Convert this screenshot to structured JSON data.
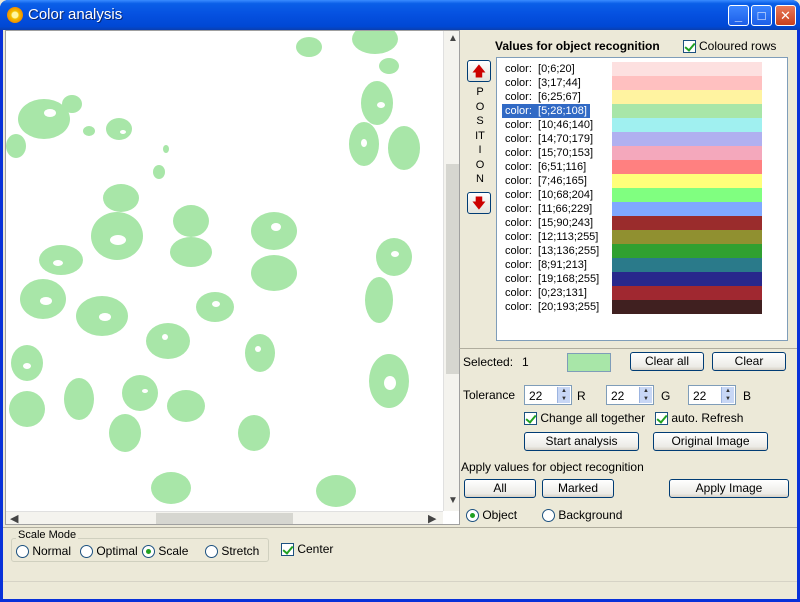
{
  "window": {
    "title": "Color analysis",
    "controls": [
      "_",
      "□",
      "✕"
    ]
  },
  "panel": {
    "title": "Values for object recognition",
    "coloured_rows_label": "Coloured rows",
    "coloured_rows_checked": true,
    "position_label": "POSITION"
  },
  "rows": [
    {
      "label": "color:  [0;6;20]",
      "color": "#fde0e0"
    },
    {
      "label": "color:  [3;17;44]",
      "color": "#ffc0c0"
    },
    {
      "label": "color:  [6;25;67]",
      "color": "#fff3a0"
    },
    {
      "label": "color:  [5;28;108]",
      "color": "#a8e6a8",
      "selected": true
    },
    {
      "label": "color:  [10;46;140]",
      "color": "#a0f0f0"
    },
    {
      "label": "color:  [14;70;179]",
      "color": "#b0b0f0"
    },
    {
      "label": "color:  [15;70;153]",
      "color": "#f4a8bc"
    },
    {
      "label": "color:  [6;51;116]",
      "color": "#ff8080"
    },
    {
      "label": "color:  [7;46;165]",
      "color": "#ffff7a"
    },
    {
      "label": "color:  [10;68;204]",
      "color": "#80ff80"
    },
    {
      "label": "color:  [11;66;229]",
      "color": "#7fa8ff"
    },
    {
      "label": "color:  [15;90;243]",
      "color": "#9a2c2c"
    },
    {
      "label": "color:  [12;113;255]",
      "color": "#909030"
    },
    {
      "label": "color:  [13;136;255]",
      "color": "#30a030"
    },
    {
      "label": "color:  [8;91;213]",
      "color": "#2a7a8a"
    },
    {
      "label": "color:  [19;168;255]",
      "color": "#28288c"
    },
    {
      "label": "color:  [0;23;131]",
      "color": "#a02830"
    },
    {
      "label": "color:  [20;193;255]",
      "color": "#402020"
    }
  ],
  "selection": {
    "selected_label": "Selected:",
    "selected_count": "1",
    "selected_color": "#a8e6a8",
    "clear_all": "Clear all",
    "clear": "Clear"
  },
  "tolerance": {
    "label": "Tolerance",
    "r": "22",
    "r_label": "R",
    "g": "22",
    "g_label": "G",
    "b": "22",
    "b_label": "B",
    "change_all_together": "Change all together",
    "change_all_checked": true,
    "auto_refresh": "auto. Refresh",
    "auto_refresh_checked": true
  },
  "actions": {
    "start_analysis": "Start analysis",
    "original_image": "Original Image",
    "apply_values_label": "Apply values for object recognition",
    "all": "All",
    "marked": "Marked",
    "apply_image": "Apply Image",
    "object": "Object",
    "background": "Background",
    "selected_target": "Object"
  },
  "scale_mode": {
    "title": "Scale Mode",
    "options": [
      "Normal",
      "Optimal",
      "Scale",
      "Stretch"
    ],
    "selected": "Scale",
    "center_label": "Center",
    "center_checked": true
  },
  "colors": {
    "cell_fill": "#a8e6a8",
    "selection_bg": "#316ac5"
  },
  "icons": {
    "up": "red-up-arrow-icon",
    "down": "red-down-arrow-icon"
  }
}
